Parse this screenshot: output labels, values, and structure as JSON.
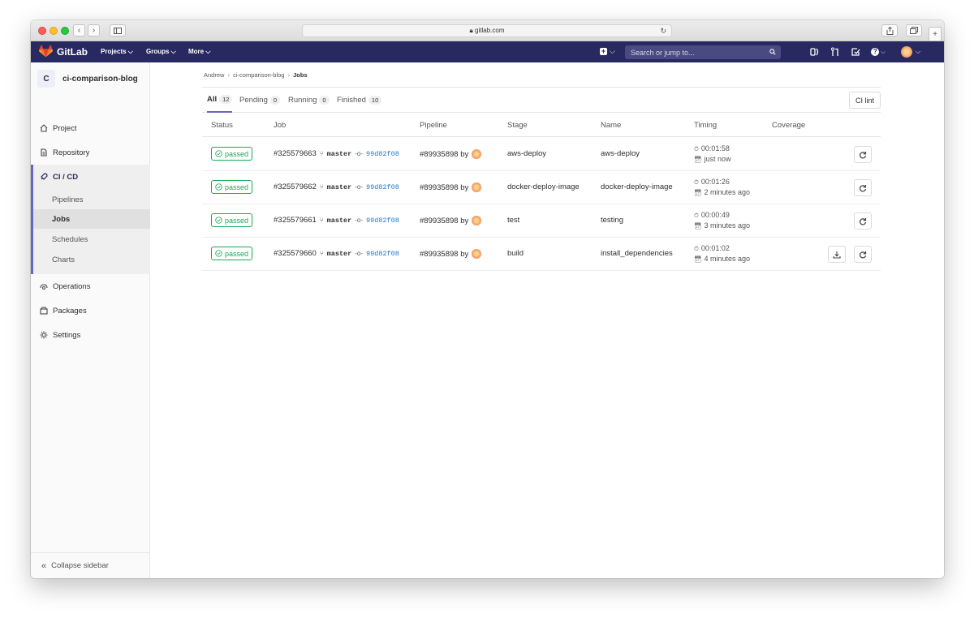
{
  "browser": {
    "url": "gitlab.com"
  },
  "navbar": {
    "brand": "GitLab",
    "links": [
      "Projects ⌵",
      "Groups ⌵",
      "More ⌵"
    ],
    "search_placeholder": "Search or jump to...",
    "accent": "#292961"
  },
  "sidebar": {
    "project_initial": "C",
    "project_name": "ci-comparison-blog",
    "items": {
      "project": "Project",
      "repository": "Repository",
      "cicd": "CI / CD",
      "operations": "Operations",
      "packages": "Packages",
      "settings": "Settings"
    },
    "cicd_sub": {
      "pipelines": "Pipelines",
      "jobs": "Jobs",
      "schedules": "Schedules",
      "charts": "Charts"
    },
    "collapse": "Collapse sidebar"
  },
  "breadcrumb": {
    "user": "Andrew",
    "project": "ci-comparison-blog",
    "current": "Jobs"
  },
  "tabs": [
    {
      "label": "All",
      "count": "12"
    },
    {
      "label": "Pending",
      "count": "0"
    },
    {
      "label": "Running",
      "count": "0"
    },
    {
      "label": "Finished",
      "count": "10"
    }
  ],
  "ci_lint_label": "CI lint",
  "columns": [
    "Status",
    "Job",
    "Pipeline",
    "Stage",
    "Name",
    "Timing",
    "Coverage"
  ],
  "jobs": [
    {
      "status": "passed",
      "id": "#325579663",
      "branch": "master",
      "sha": "99d82f08",
      "pipeline": "#89935898 by",
      "stage": "aws-deploy",
      "name": "aws-deploy",
      "duration": "00:01:58",
      "finished": "just now",
      "artifacts": false
    },
    {
      "status": "passed",
      "id": "#325579662",
      "branch": "master",
      "sha": "99d82f08",
      "pipeline": "#89935898 by",
      "stage": "docker-deploy-image",
      "name": "docker-deploy-image",
      "duration": "00:01:26",
      "finished": "2 minutes ago",
      "artifacts": false
    },
    {
      "status": "passed",
      "id": "#325579661",
      "branch": "master",
      "sha": "99d82f08",
      "pipeline": "#89935898 by",
      "stage": "test",
      "name": "testing",
      "duration": "00:00:49",
      "finished": "3 minutes ago",
      "artifacts": false
    },
    {
      "status": "passed",
      "id": "#325579660",
      "branch": "master",
      "sha": "99d82f08",
      "pipeline": "#89935898 by",
      "stage": "build",
      "name": "install_dependencies",
      "duration": "00:01:02",
      "finished": "4 minutes ago",
      "artifacts": true
    }
  ],
  "colors": {
    "passed": "#1aaa55",
    "link": "#1f78d1",
    "active_indicator": "#6666c4"
  }
}
